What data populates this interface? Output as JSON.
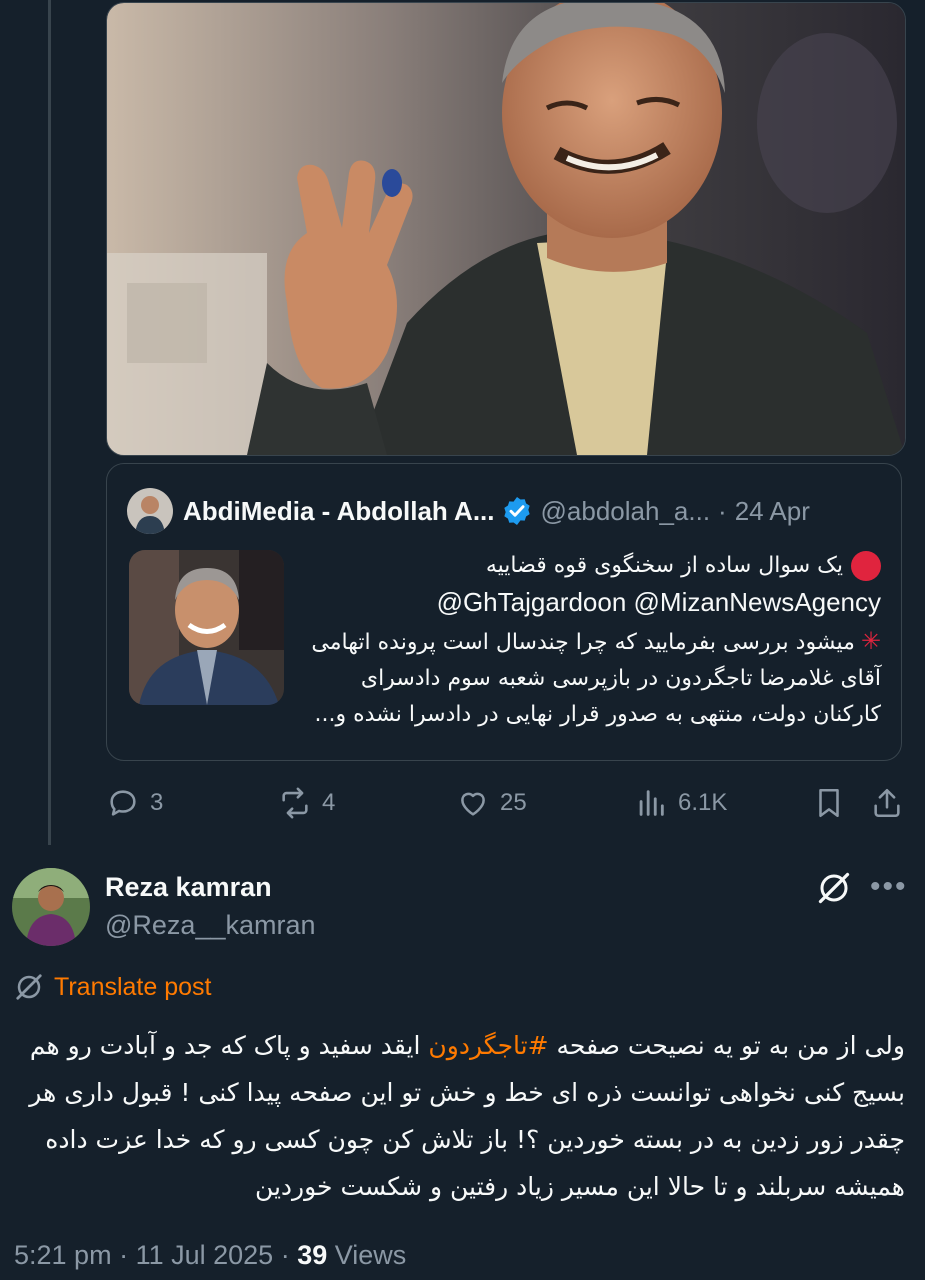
{
  "quoted_post": {
    "author_name": "AbdiMedia - Abdollah A...",
    "author_handle": "@abdolah_a...",
    "separator": "·",
    "date": "24 Apr",
    "line1": "یک سوال ساده از سخنگوی قوه قضاییه",
    "line2": "@GhTajgardoon @MizanNewsAgency",
    "line3": "میشود بررسی بفرمایید که چرا چندسال است پرونده اتهامی",
    "line4": "آقای غلامرضا تاجگردون در بازپرسی شعبه سوم دادسرای",
    "line5": "کارکنان دولت، منتهی به صدور قرار نهایی در دادسرا نشده و..."
  },
  "actions": {
    "replies": "3",
    "reposts": "4",
    "likes": "25",
    "views": "6.1K"
  },
  "reply": {
    "name": "Reza kamran",
    "handle": "@Reza__kamran",
    "translate_label": "Translate post",
    "text_before": "ولی از من به تو یه نصیحت صفحه ",
    "hashtag": "#تاجگردون",
    "text_after": " ایقد سفید و پاک که جد و آبادت رو هم بسیج کنی نخواهی توانست ذره ای خط و خش تو این صفحه پیدا کنی ! قبول داری هر چقدر زور زدین به در بسته خوردین ؟! باز تلاش کن چون کسی رو که خدا عزت داده همیشه سربلند و تا حالا این مسیر زیاد رفتین و شکست خوردین",
    "time": "5:21 pm",
    "date": "11 Jul 2025",
    "views_count": "39",
    "views_label": "Views"
  },
  "colors": {
    "background": "#15202b",
    "border": "#38444d",
    "muted": "#8b98a5",
    "accent": "#ff7a00",
    "verified": "#1d9bf0"
  },
  "icons": [
    "verified-badge-icon",
    "red-circle-icon",
    "anger-symbol-icon",
    "reply-icon",
    "repost-icon",
    "like-icon",
    "views-icon",
    "bookmark-icon",
    "share-icon",
    "grok-icon",
    "more-icon",
    "translate-icon"
  ]
}
